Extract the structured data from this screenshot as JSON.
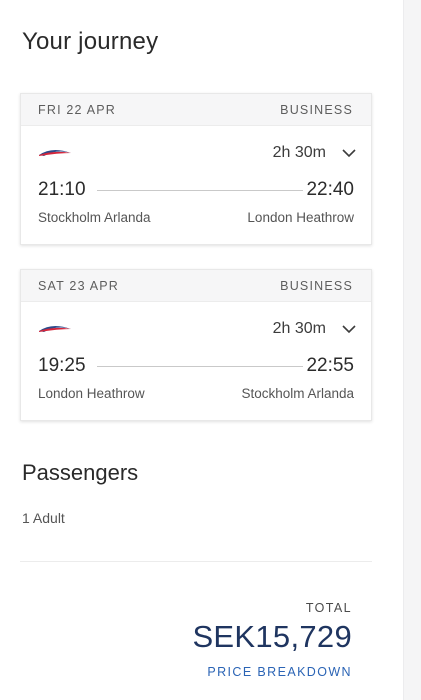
{
  "journey": {
    "title": "Your journey",
    "flights": [
      {
        "date": "FRI 22 APR",
        "cabin": "BUSINESS",
        "duration": "2h 30m",
        "departure_time": "21:10",
        "arrival_time": "22:40",
        "departure_place": "Stockholm Arlanda",
        "arrival_place": "London Heathrow",
        "airline_icon": "ba-speedmarque-icon"
      },
      {
        "date": "SAT 23 APR",
        "cabin": "BUSINESS",
        "duration": "2h 30m",
        "departure_time": "19:25",
        "arrival_time": "22:55",
        "departure_place": "London Heathrow",
        "arrival_place": "Stockholm Arlanda",
        "airline_icon": "ba-speedmarque-icon"
      }
    ]
  },
  "passengers": {
    "title": "Passengers",
    "count": "1 Adult"
  },
  "total": {
    "label": "TOTAL",
    "price": "SEK15,729",
    "breakdown_link": "PRICE BREAKDOWN"
  },
  "colors": {
    "price": "#1f3560",
    "link": "#2b64b5",
    "logo_red": "#d4253a",
    "logo_blue": "#2d4a8a"
  }
}
